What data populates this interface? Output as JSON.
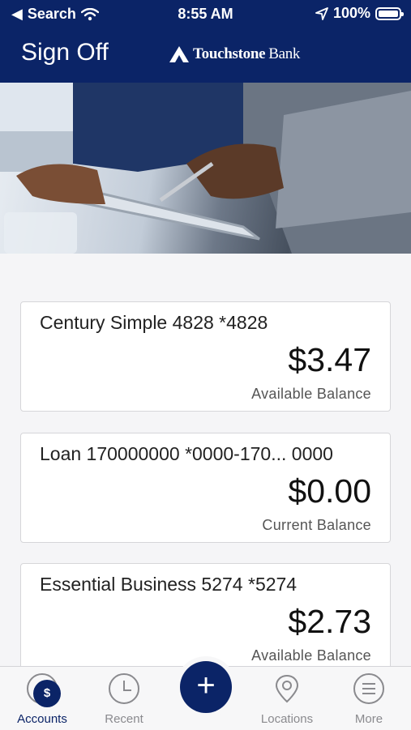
{
  "status": {
    "carrier": "Search",
    "time": "8:55 AM",
    "battery": "100%"
  },
  "header": {
    "sign_off": "Sign Off",
    "brand_name": "Touchstone",
    "brand_bank": "Bank"
  },
  "accounts": [
    {
      "name": "Century Simple 4828 *4828",
      "amount": "$3.47",
      "label": "Available Balance"
    },
    {
      "name": "Loan 170000000 *0000-170... 0000",
      "amount": "$0.00",
      "label": "Current Balance"
    },
    {
      "name": "Essential Business 5274 *5274",
      "amount": "$2.73",
      "label": "Available Balance"
    }
  ],
  "tabs": {
    "accounts": "Accounts",
    "recent": "Recent",
    "add": "+",
    "locations": "Locations",
    "more": "More"
  },
  "colors": {
    "brand_navy": "#0b2467"
  }
}
